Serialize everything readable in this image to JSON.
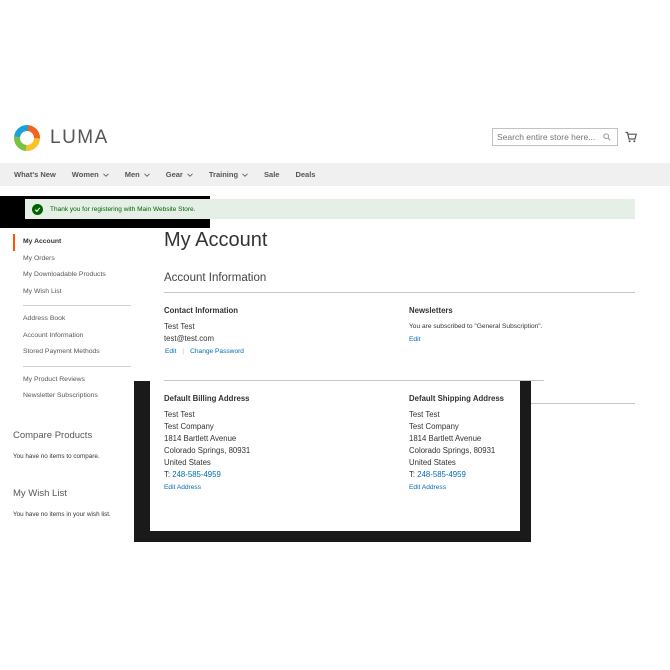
{
  "brand": {
    "name": "LUMA"
  },
  "search": {
    "placeholder": "Search entire store here..."
  },
  "nav": {
    "items": [
      {
        "label": "What's New",
        "has_menu": false
      },
      {
        "label": "Women",
        "has_menu": true
      },
      {
        "label": "Men",
        "has_menu": true
      },
      {
        "label": "Gear",
        "has_menu": true
      },
      {
        "label": "Training",
        "has_menu": true
      },
      {
        "label": "Sale",
        "has_menu": false
      },
      {
        "label": "Deals",
        "has_menu": false
      }
    ]
  },
  "message": {
    "text": "Thank you for registering with Main Website Store."
  },
  "sidebar": {
    "items": [
      "My Account",
      "My Orders",
      "My Downloadable Products",
      "My Wish List",
      "Address Book",
      "Account Information",
      "Stored Payment Methods",
      "My Product Reviews",
      "Newsletter Subscriptions"
    ],
    "active": "My Account"
  },
  "compare": {
    "title": "Compare Products",
    "empty": "You have no items to compare."
  },
  "wishlist": {
    "title": "My Wish List",
    "empty": "You have no items in your wish list."
  },
  "main": {
    "title": "My Account",
    "account_info_title": "Account Information",
    "contact": {
      "title": "Contact Information",
      "name": "Test Test",
      "email": "test@test.com",
      "edit_label": "Edit",
      "separator": "|",
      "change_password_label": "Change Password"
    },
    "newsletters": {
      "title": "Newsletters",
      "text": "You are subscribed to \"General Subscription\".",
      "edit_label": "Edit"
    },
    "billing": {
      "title": "Default Billing Address",
      "name": "Test Test",
      "company": "Test Company",
      "street": "1814 Bartlett Avenue",
      "city": "Colorado Springs, 80931",
      "country": "United States",
      "phone_prefix": "T:",
      "phone": "248-585-4959",
      "edit_label": "Edit Address"
    },
    "shipping": {
      "title": "Default Shipping Address",
      "name": "Test Test",
      "company": "Test Company",
      "street": "1814 Bartlett Avenue",
      "city": "Colorado Springs, 80931",
      "country": "United States",
      "phone_prefix": "T:",
      "phone": "248-585-4959",
      "edit_label": "Edit Address"
    }
  },
  "colors": {
    "accent": "#ff5501",
    "link": "#006bb4",
    "success_bg": "#e5efe5",
    "success_text": "#006400",
    "nav_bg": "#f0f0f0"
  },
  "icons": {
    "logo": "luma-logo-icon",
    "search": "search-icon",
    "cart": "cart-icon",
    "success": "check-circle-icon",
    "menu": "chevron-down-icon"
  }
}
